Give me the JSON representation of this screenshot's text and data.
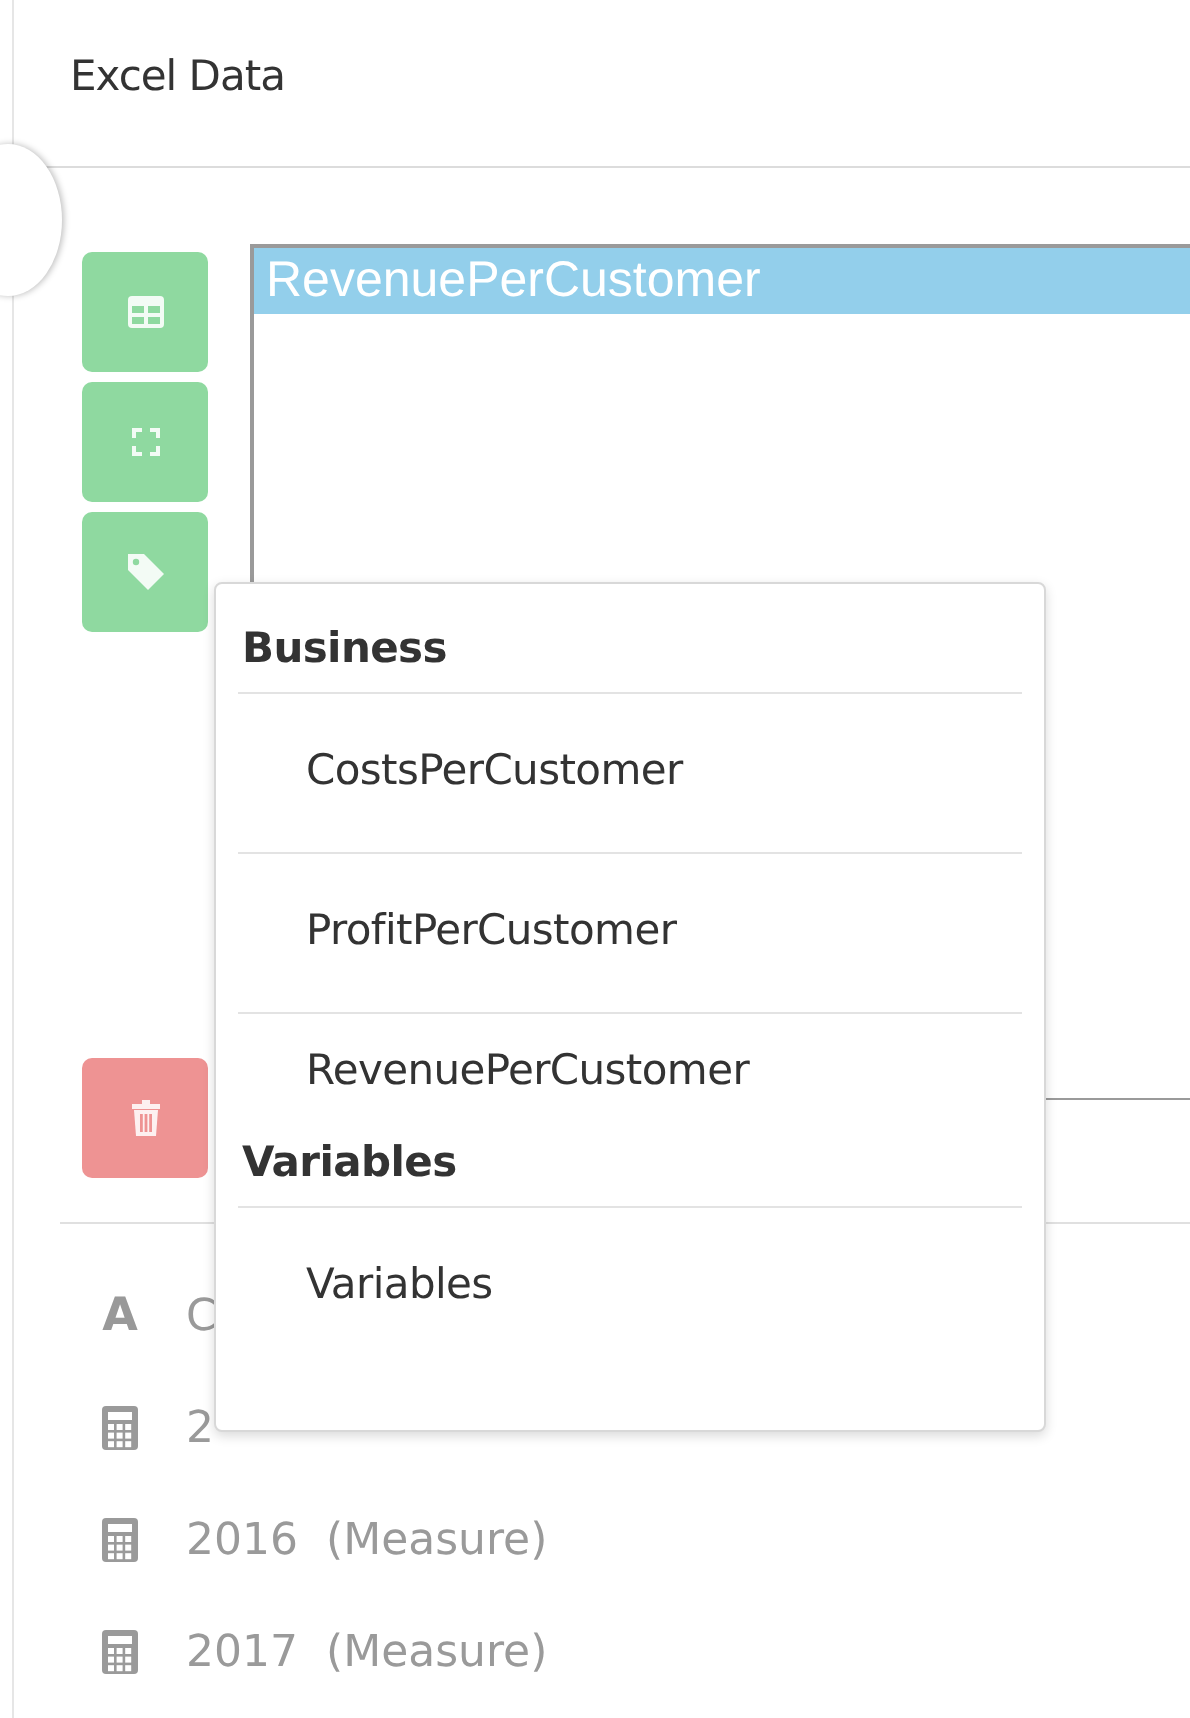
{
  "panel": {
    "title": "Excel Data"
  },
  "tool_buttons": [
    {
      "kind": "table"
    },
    {
      "kind": "expand"
    },
    {
      "kind": "tag"
    }
  ],
  "delete_button": {
    "kind": "trash"
  },
  "listbox": {
    "items": [
      {
        "label": "RevenuePerCustomer",
        "selected": true
      }
    ]
  },
  "fields": [
    {
      "kind": "dimension",
      "icon": "A",
      "label": "C"
    },
    {
      "kind": "measure",
      "label": "2"
    },
    {
      "kind": "measure",
      "label": "2016",
      "type_label": "(Measure)"
    },
    {
      "kind": "measure",
      "label": "2017",
      "type_label": "(Measure)"
    }
  ],
  "tag_menu": {
    "groups": [
      {
        "heading": "Business",
        "items": [
          "CostsPerCustomer",
          "ProfitPerCustomer",
          "RevenuePerCustomer"
        ]
      },
      {
        "heading": "Variables",
        "items": [
          "Variables"
        ]
      }
    ]
  }
}
